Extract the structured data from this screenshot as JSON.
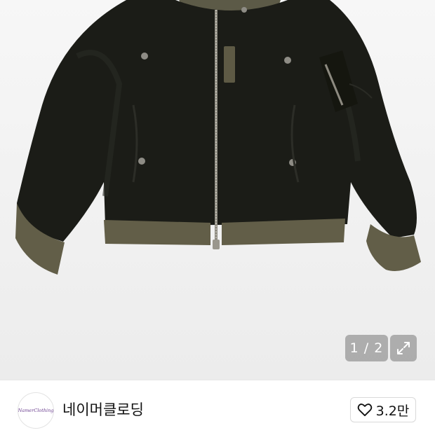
{
  "gallery": {
    "product_image": "black bomber jacket with olive green ribbed cuffs and hem",
    "counter": "1 / 2",
    "expand_icon": "expand-arrows-icon"
  },
  "store": {
    "logo_text": "NamerClothing",
    "name": "네이머클로딩"
  },
  "like": {
    "icon": "heart-outline-icon",
    "count": "3.2만"
  },
  "colors": {
    "jacket": "#1b1c17",
    "rib": "#625e48",
    "background": "#f2f2f2",
    "overlay": "#8a8a8a"
  }
}
